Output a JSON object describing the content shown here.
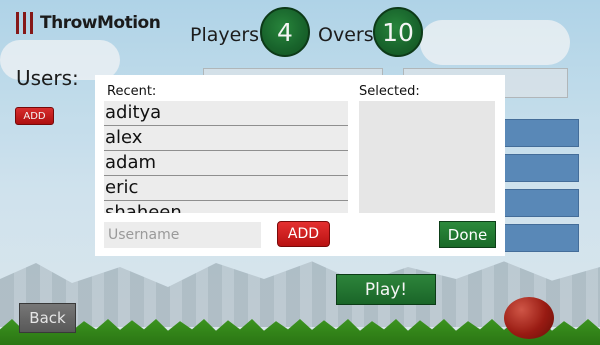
{
  "app": {
    "logo_text": "ThrowMotion"
  },
  "header": {
    "players_label": "Players:",
    "players_value": "4",
    "overs_label": "Overs:",
    "overs_value": "10"
  },
  "main": {
    "users_label": "Users:",
    "add_label": "ADD",
    "play_label": "Play!",
    "back_label": "Back"
  },
  "dialog": {
    "recent_label": "Recent:",
    "selected_label": "Selected:",
    "recent_items": [
      "aditya",
      "alex",
      "adam",
      "eric",
      "shaheen"
    ],
    "username_placeholder": "Username",
    "add_label": "ADD",
    "done_label": "Done"
  },
  "icons": [
    "stumps-icon",
    "cricket-ball-icon"
  ],
  "colors": {
    "accent_green": "#1c6a2a",
    "accent_red": "#c41a1a",
    "slot_blue": "#5d8ebf"
  }
}
